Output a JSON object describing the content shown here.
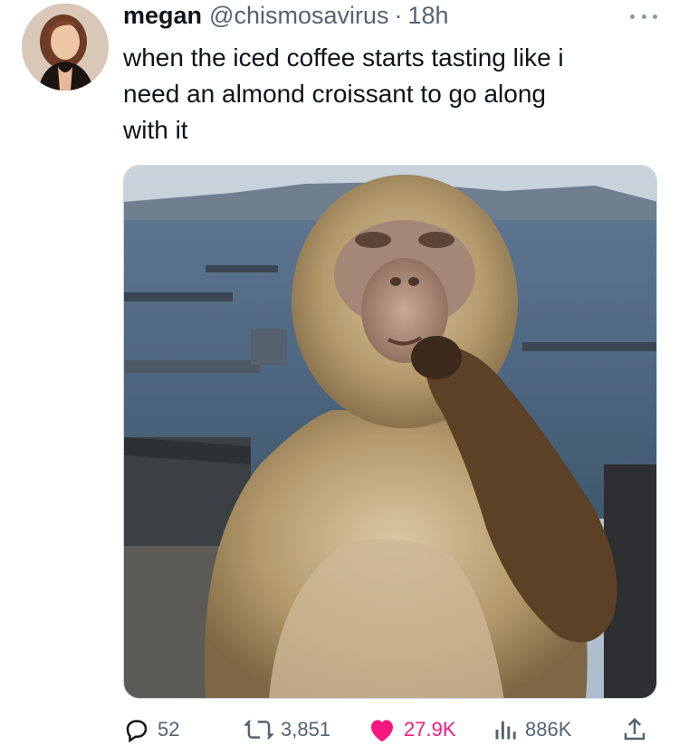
{
  "author": {
    "name": "megan",
    "handle": "@chismosavirus",
    "separator": "·",
    "time": "18h"
  },
  "tweet": {
    "text": "when the iced coffee starts tasting like i\nneed an almond croissant to go along\nwith it"
  },
  "media": {
    "icon": "photo-monkey-thinking"
  },
  "actions": {
    "replies": "52",
    "retweets": "3,851",
    "likes": "27.9K",
    "views": "886K"
  },
  "colors": {
    "text": "#0f1419",
    "secondary": "#536471",
    "like": "#f91880"
  }
}
